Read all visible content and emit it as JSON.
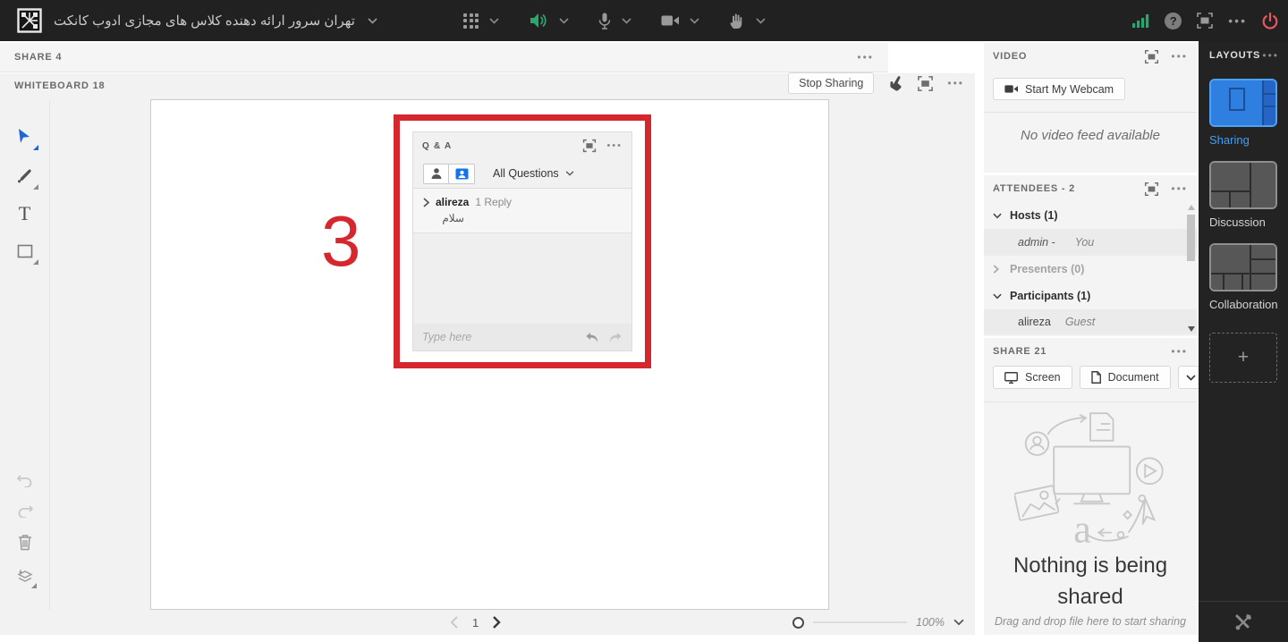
{
  "colors": {
    "accent_blue": "#1473e6",
    "annotation_red": "#d7272e",
    "audio_green": "#2aa76d",
    "power_red": "#e05a5f",
    "topbar_bg": "#212121",
    "pod_bg": "#f4f4f4"
  },
  "icons": {
    "ellipsis": "•••",
    "plus": "+",
    "help": "?"
  },
  "topbar": {
    "room_title": "تهران سرور ارائه دهنده کلاس های مجازی ادوب کانکت"
  },
  "share_pod": {
    "title": "SHARE 4"
  },
  "whiteboard": {
    "title": "WHITEBOARD 18",
    "stop_sharing_label": "Stop Sharing",
    "annotation_number": "3",
    "page_number": "1",
    "zoom_level": "100%"
  },
  "qa_pod": {
    "title": "Q & A",
    "filter_label": "All Questions",
    "question_author": "alireza",
    "reply_count": "1 Reply",
    "question_text": "سلام",
    "input_placeholder": "Type here"
  },
  "video_pod": {
    "title": "VIDEO",
    "start_webcam_label": "Start My Webcam",
    "empty_message": "No video feed available"
  },
  "attendees_pod": {
    "title": "ATTENDEES - 2",
    "hosts_group": "Hosts (1)",
    "host_name": "admin -",
    "host_tag": "You",
    "presenters_group": "Presenters (0)",
    "participants_group": "Participants (1)",
    "participant_name": "alireza",
    "participant_role": "Guest"
  },
  "share21_pod": {
    "title": "SHARE 21",
    "screen_label": "Screen",
    "document_label": "Document",
    "empty_title": "Nothing is being shared",
    "empty_hint": "Drag and drop file here to start sharing"
  },
  "layouts_panel": {
    "title": "LAYOUTS",
    "items": [
      {
        "label": "Sharing"
      },
      {
        "label": "Discussion"
      },
      {
        "label": "Collaboration"
      }
    ]
  }
}
